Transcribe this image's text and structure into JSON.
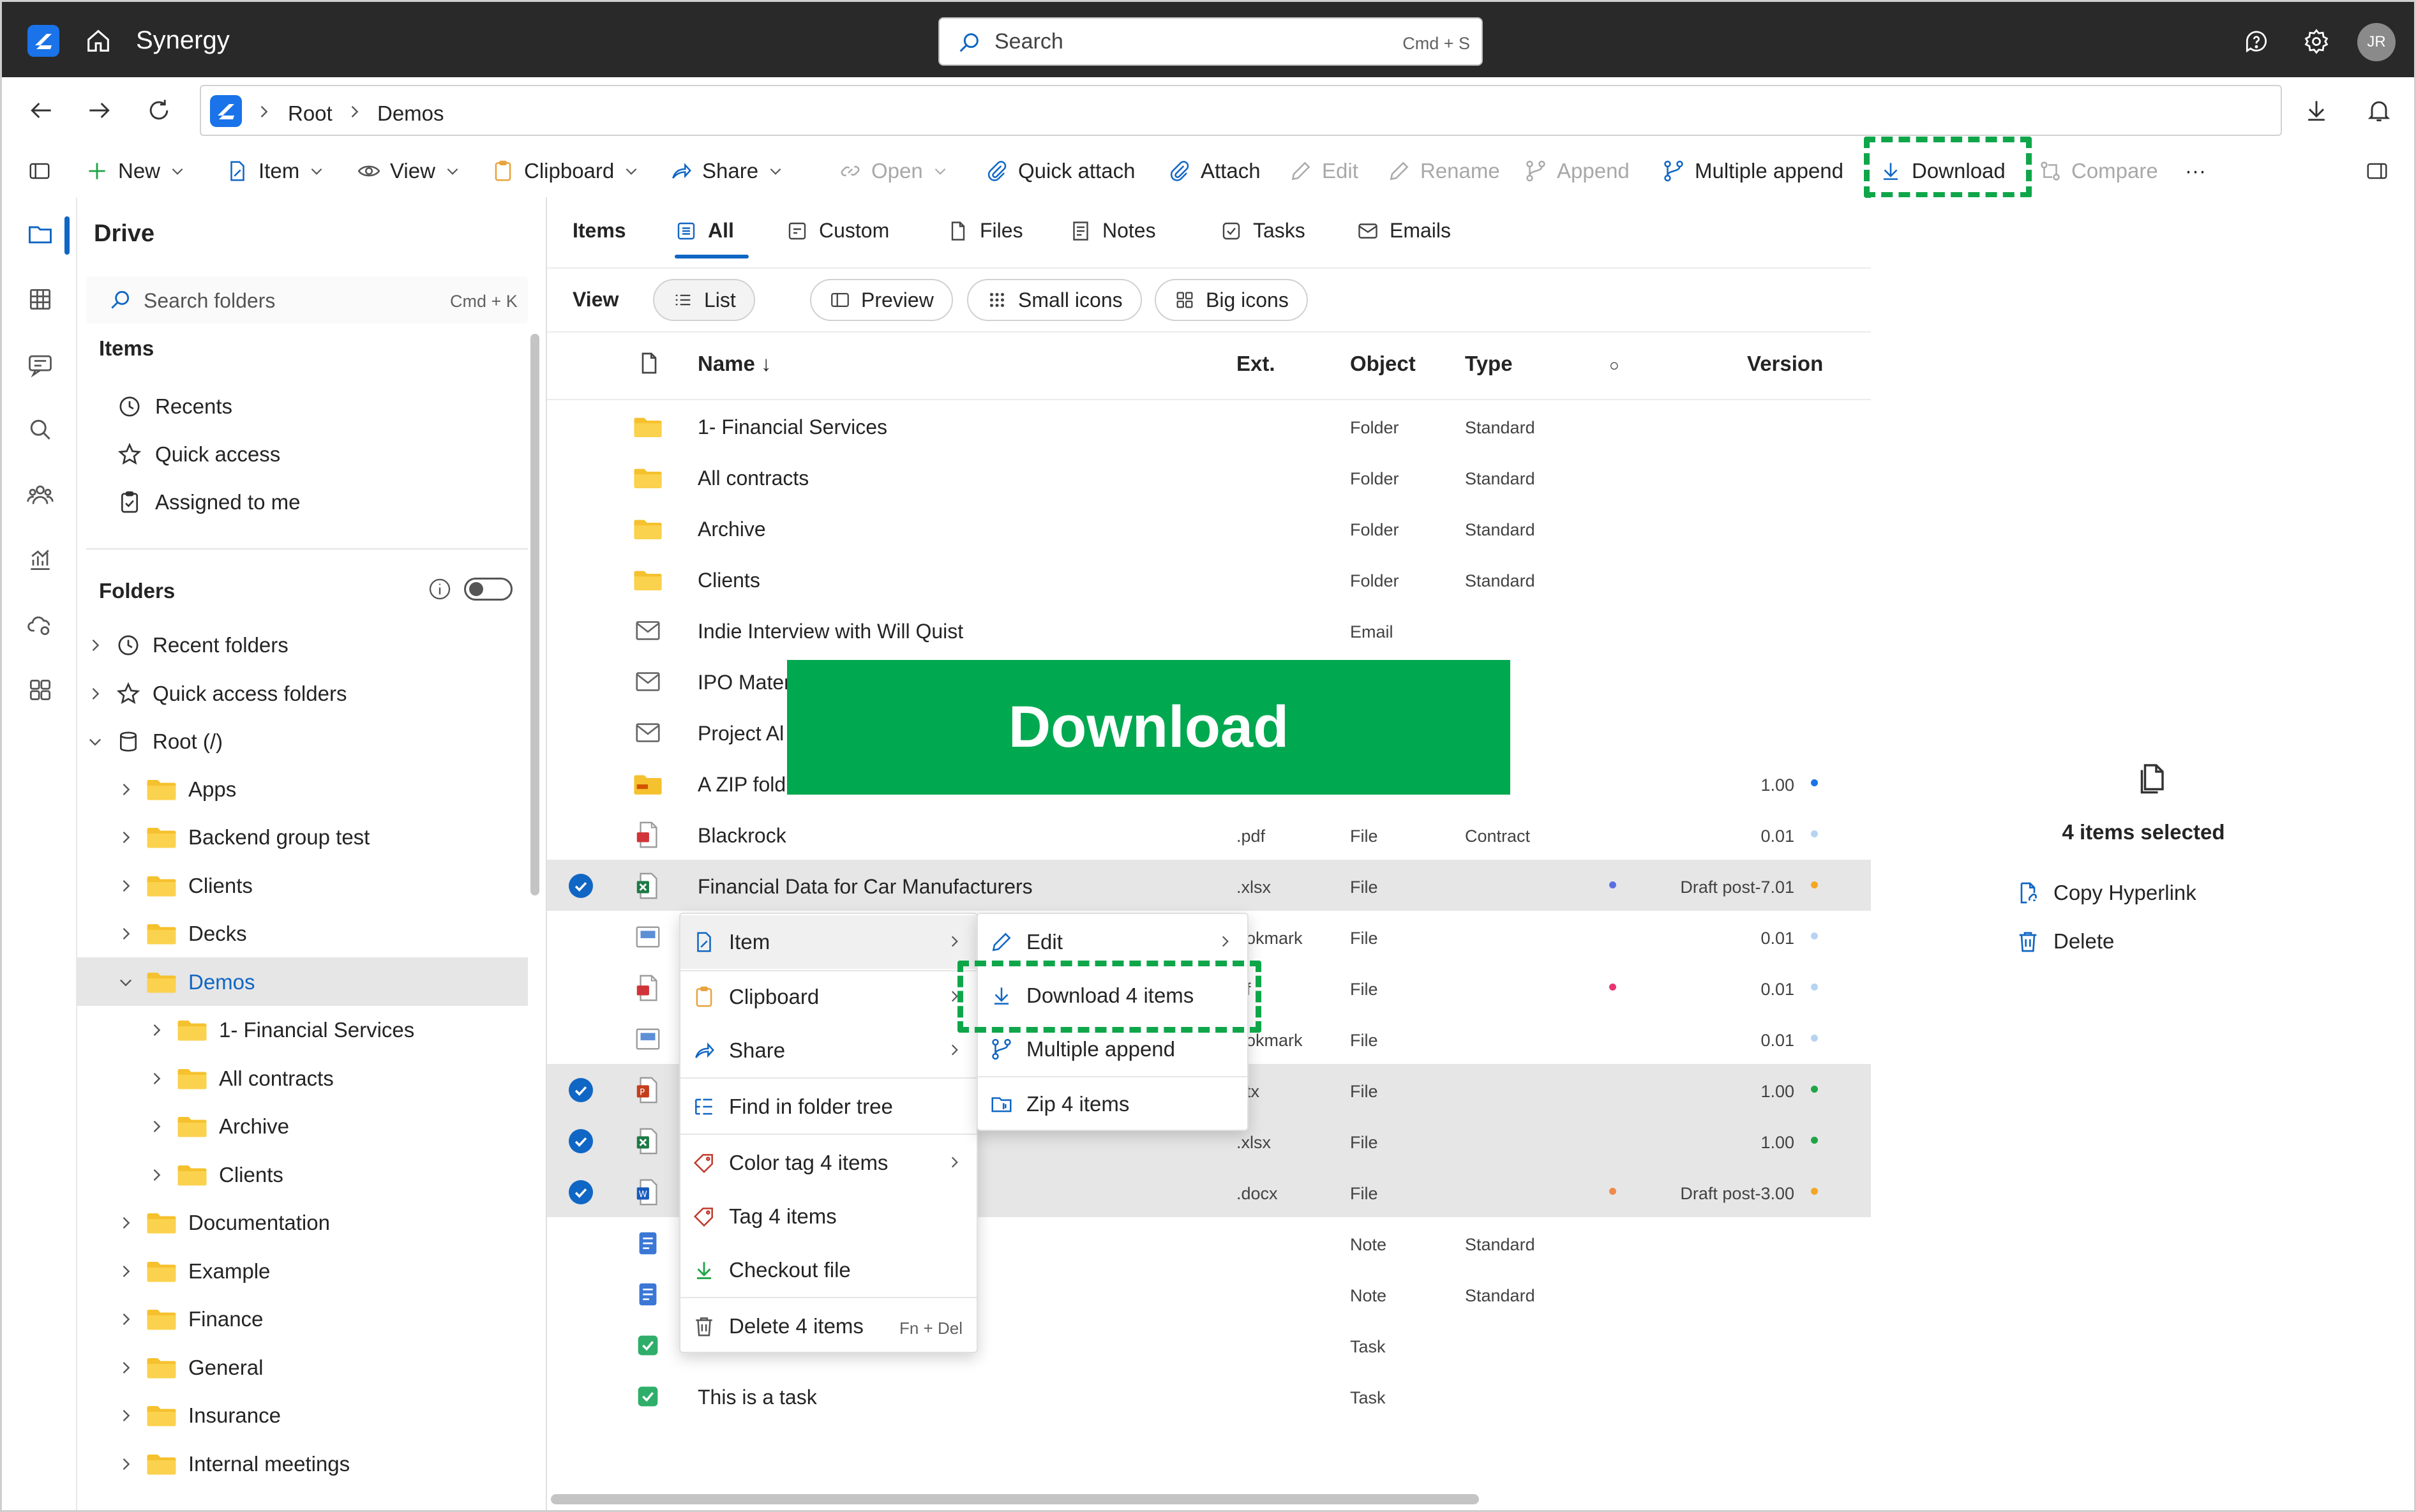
{
  "app": {
    "name": "Synergy",
    "user_initials": "JR"
  },
  "search": {
    "placeholder": "Search",
    "shortcut": "Cmd + S"
  },
  "breadcrumb": [
    "Root",
    "Demos"
  ],
  "toolbar": {
    "new": "New",
    "item": "Item",
    "view": "View",
    "clipboard": "Clipboard",
    "share": "Share",
    "open": "Open",
    "quick_attach": "Quick attach",
    "attach": "Attach",
    "edit": "Edit",
    "rename": "Rename",
    "append": "Append",
    "multiple_append": "Multiple append",
    "download": "Download",
    "compare": "Compare",
    "more": "···"
  },
  "sidebar": {
    "title": "Drive",
    "search_placeholder": "Search folders",
    "search_shortcut": "Cmd + K",
    "items_heading": "Items",
    "items": [
      "Recents",
      "Quick access",
      "Assigned to me"
    ],
    "folders_heading": "Folders",
    "tree": {
      "recent_folders": "Recent folders",
      "quick_access_folders": "Quick access folders",
      "root": "Root (/)",
      "root_children": [
        "Apps",
        "Backend group test",
        "Clients",
        "Decks",
        "Demos"
      ],
      "demos_children": [
        "1- Financial Services",
        "All contracts",
        "Archive",
        "Clients"
      ],
      "after_demos": [
        "Documentation",
        "Example",
        "Finance",
        "General",
        "Insurance",
        "Internal meetings"
      ]
    }
  },
  "tabs": {
    "items": "Items",
    "all": "All",
    "custom": "Custom",
    "files": "Files",
    "notes": "Notes",
    "tasks": "Tasks",
    "emails": "Emails"
  },
  "view_options": {
    "label": "View",
    "list": "List",
    "preview": "Preview",
    "small_icons": "Small icons",
    "big_icons": "Big icons"
  },
  "columns": {
    "name": "Name ↓",
    "ext": "Ext.",
    "object": "Object",
    "type": "Type",
    "status": "○",
    "version": "Version"
  },
  "rows": [
    {
      "icon": "folder",
      "name": "1- Financial Services",
      "ext": "",
      "object": "Folder",
      "type": "Standard",
      "version": "",
      "dot": "",
      "vdot": "",
      "sel": false
    },
    {
      "icon": "folder",
      "name": "All contracts",
      "ext": "",
      "object": "Folder",
      "type": "Standard",
      "version": "",
      "dot": "",
      "vdot": "",
      "sel": false
    },
    {
      "icon": "folder",
      "name": "Archive",
      "ext": "",
      "object": "Folder",
      "type": "Standard",
      "version": "",
      "dot": "",
      "vdot": "",
      "sel": false
    },
    {
      "icon": "folder",
      "name": "Clients",
      "ext": "",
      "object": "Folder",
      "type": "Standard",
      "version": "",
      "dot": "",
      "vdot": "",
      "sel": false
    },
    {
      "icon": "email",
      "name": "Indie Interview with Will Quist",
      "ext": "",
      "object": "Email",
      "type": "",
      "version": "",
      "dot": "",
      "vdot": "",
      "sel": false
    },
    {
      "icon": "email",
      "name": "IPO Mater",
      "ext": "",
      "object": "",
      "type": "",
      "version": "",
      "dot": "",
      "vdot": "",
      "sel": false
    },
    {
      "icon": "email",
      "name": "Project Al",
      "ext": "",
      "object": "",
      "type": "",
      "version": "",
      "dot": "",
      "vdot": "",
      "sel": false
    },
    {
      "icon": "zip",
      "name": "A ZIP fold",
      "ext": "",
      "object": "",
      "type": "",
      "version": "1.00",
      "dot": "",
      "vdot": "#1a73e8",
      "sel": false
    },
    {
      "icon": "pdf",
      "name": "Blackrock",
      "ext": ".pdf",
      "object": "File",
      "type": "Contract",
      "version": "0.01",
      "dot": "",
      "vdot": "#b6d4f2",
      "sel": false
    },
    {
      "icon": "xlsx",
      "name": "Financial Data for Car Manufacturers",
      "ext": ".xlsx",
      "object": "File",
      "type": "",
      "version": "Draft post-7.01",
      "dot": "#5b6ee1",
      "vdot": "#f5a623",
      "sel": true
    },
    {
      "icon": "bookmark",
      "name": "",
      "ext": "ookmark",
      "object": "File",
      "type": "",
      "version": "0.01",
      "dot": "",
      "vdot": "#b6d4f2",
      "sel": false
    },
    {
      "icon": "pdf",
      "name": "",
      "ext": "df",
      "object": "File",
      "type": "",
      "version": "0.01",
      "dot": "#e8336e",
      "vdot": "#b6d4f2",
      "sel": false
    },
    {
      "icon": "bookmark",
      "name": "",
      "ext": "ookmark",
      "object": "File",
      "type": "",
      "version": "0.01",
      "dot": "",
      "vdot": "#b6d4f2",
      "sel": false
    },
    {
      "icon": "pptx",
      "name": "",
      "ext": "ptx",
      "object": "File",
      "type": "",
      "version": "1.00",
      "dot": "",
      "vdot": "#1ea446",
      "sel": true
    },
    {
      "icon": "xlsx",
      "name": "",
      "ext": ".xlsx",
      "object": "File",
      "type": "",
      "version": "1.00",
      "dot": "",
      "vdot": "#1ea446",
      "sel": true
    },
    {
      "icon": "docx",
      "name": "",
      "ext": ".docx",
      "object": "File",
      "type": "",
      "version": "Draft post-3.00",
      "dot": "#f08a4b",
      "vdot": "#f5a623",
      "sel": true
    },
    {
      "icon": "note",
      "name": "",
      "ext": "",
      "object": "Note",
      "type": "Standard",
      "version": "",
      "dot": "",
      "vdot": "",
      "sel": false
    },
    {
      "icon": "note",
      "name": "",
      "ext": "",
      "object": "Note",
      "type": "Standard",
      "version": "",
      "dot": "",
      "vdot": "",
      "sel": false
    },
    {
      "icon": "task",
      "name": "",
      "ext": "",
      "object": "Task",
      "type": "",
      "version": "",
      "dot": "",
      "vdot": "",
      "sel": false
    },
    {
      "icon": "task",
      "name": "This is a task",
      "ext": "",
      "object": "Task",
      "type": "",
      "version": "",
      "dot": "",
      "vdot": "",
      "sel": false
    }
  ],
  "banner": "Download",
  "context_menu": {
    "item": "Item",
    "clipboard": "Clipboard",
    "share": "Share",
    "find_in_tree": "Find in folder tree",
    "color_tag": "Color tag 4 items",
    "tag": "Tag 4 items",
    "checkout": "Checkout file",
    "delete": "Delete 4 items",
    "delete_shortcut": "Fn + Del"
  },
  "submenu": {
    "edit": "Edit",
    "download": "Download 4 items",
    "multiple_append": "Multiple append",
    "zip": "Zip 4 items"
  },
  "right_panel": {
    "selected": "4 items selected",
    "copy_hyperlink": "Copy Hyperlink",
    "delete": "Delete"
  },
  "colors": {
    "accent": "#1066c4",
    "highlight": "#0fa64a",
    "banner": "#00a84f",
    "topbar": "#292929",
    "folder": "#f5c12e"
  }
}
